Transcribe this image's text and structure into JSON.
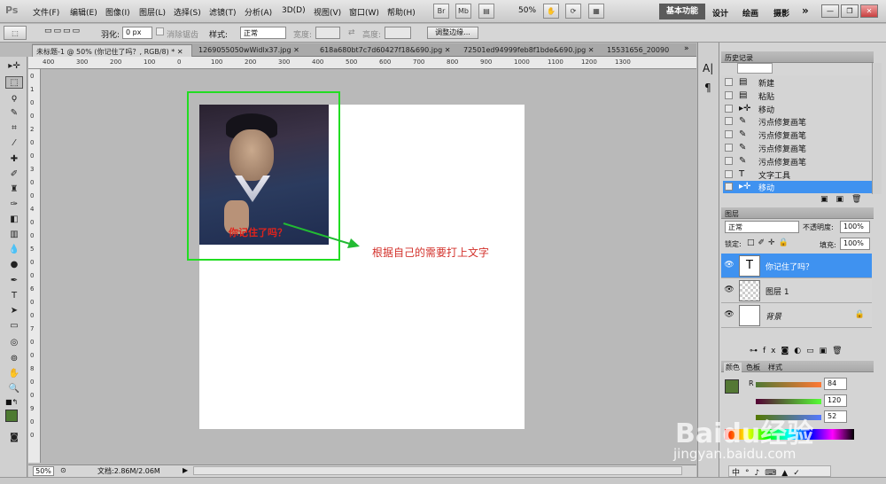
{
  "app": {
    "logo": "Ps"
  },
  "menus": [
    "文件(F)",
    "编辑(E)",
    "图像(I)",
    "图层(L)",
    "选择(S)",
    "滤镜(T)",
    "分析(A)",
    "3D(D)",
    "视图(V)",
    "窗口(W)",
    "帮助(H)"
  ],
  "appbar": {
    "br_label": "Br",
    "mb_label": "Mb",
    "zoom": "50%"
  },
  "workspaces": {
    "active": "基本功能",
    "design": "设计",
    "painting": "绘画",
    "photography": "摄影",
    "more": "»"
  },
  "options": {
    "feather_label": "羽化:",
    "feather_value": "0 px",
    "antialias_label": "消除锯齿",
    "style_label": "样式:",
    "style_value": "正常",
    "width_label": "宽度:",
    "height_label": "高度:",
    "refine_edge": "调整边缘..."
  },
  "tabs": [
    {
      "label": "未标题-1 @ 50% (你记住了吗？, RGB/8) *",
      "active": true
    },
    {
      "label": "1269055050wWidlx37.jpg",
      "active": false
    },
    {
      "label": "618a680bt7c7d60427f18&690.jpg",
      "active": false
    },
    {
      "label": "72501ed94999feb8f1bde&690.jpg",
      "active": false
    },
    {
      "label": "15531656_20090",
      "active": false
    }
  ],
  "ruler_top": [
    "400",
    "300",
    "200",
    "100",
    "0",
    "100",
    "200",
    "300",
    "400",
    "500",
    "600",
    "700",
    "800",
    "900",
    "1000",
    "1100",
    "1200",
    "1300"
  ],
  "ruler_left": [
    "0",
    "1",
    "0",
    "0",
    "2",
    "0",
    "0",
    "3",
    "0",
    "0",
    "4",
    "0",
    "0",
    "5",
    "0",
    "0",
    "6",
    "0",
    "0",
    "7",
    "0",
    "0",
    "8",
    "0",
    "0",
    "9",
    "0",
    "0"
  ],
  "canvas": {
    "photo_caption": "你记住了吗？",
    "annotation": "根据自己的需要打上文字"
  },
  "status": {
    "zoom": "50%",
    "doc_info": "文档:2.86M/2.06M"
  },
  "history": {
    "title": "历史记录",
    "items": [
      {
        "icon": "doc-icon",
        "label": "新建",
        "selected": false
      },
      {
        "icon": "doc-icon",
        "label": "粘贴",
        "selected": false
      },
      {
        "icon": "move-icon",
        "label": "移动",
        "selected": false
      },
      {
        "icon": "brush-icon",
        "label": "污点修复画笔",
        "selected": false
      },
      {
        "icon": "brush-icon",
        "label": "污点修复画笔",
        "selected": false
      },
      {
        "icon": "brush-icon",
        "label": "污点修复画笔",
        "selected": false
      },
      {
        "icon": "brush-icon",
        "label": "污点修复画笔",
        "selected": false
      },
      {
        "icon": "text-icon",
        "label": "文字工具",
        "selected": false
      },
      {
        "icon": "move-icon",
        "label": "移动",
        "selected": true
      }
    ]
  },
  "layers": {
    "title": "图层",
    "blend_mode": "正常",
    "opacity_label": "不透明度:",
    "opacity_value": "100%",
    "lock_label": "锁定:",
    "fill_label": "填充:",
    "fill_value": "100%",
    "items": [
      {
        "name": "你记住了吗？",
        "type": "text",
        "selected": true
      },
      {
        "name": "图层 1",
        "type": "image",
        "selected": false
      },
      {
        "name": "背景",
        "type": "background",
        "selected": false,
        "locked": true
      }
    ]
  },
  "color": {
    "tabs": [
      "颜色",
      "色板",
      "样式"
    ],
    "r_label": "R",
    "r_value": "84",
    "g_value": "120",
    "b_value": "52",
    "swatch": "#547834"
  },
  "watermark": {
    "text": "Baidu经验",
    "url": "jingyan.baidu.com"
  },
  "ime_bar": [
    "中",
    "°",
    "♪",
    "⌨",
    "👕",
    "🔧"
  ]
}
